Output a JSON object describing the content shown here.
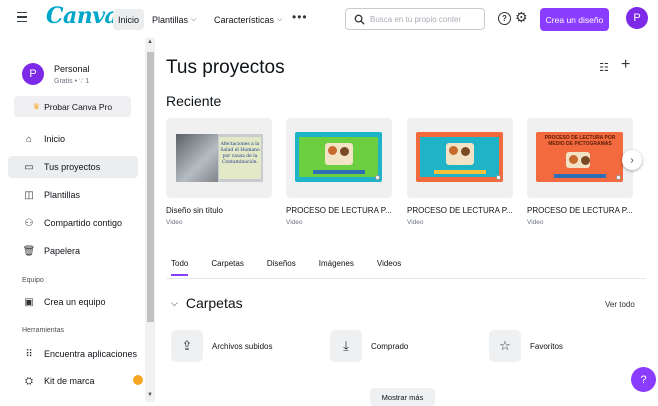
{
  "topbar": {
    "logo": "Canva",
    "nav": [
      {
        "label": "Inicio",
        "active": true
      },
      {
        "label": "Plantillas",
        "chevron": "⌵"
      },
      {
        "label": "Características",
        "chevron": "⌵"
      }
    ],
    "more": "•••",
    "search_placeholder": "Busca en tu propio conter",
    "create_label": "Crea un diseño",
    "avatar_letter": "P",
    "help_glyph": "?",
    "gear_glyph": "⚙"
  },
  "sidebar": {
    "profile": {
      "letter": "P",
      "name": "Personal",
      "sub": "Gratis • ∵ 1"
    },
    "pro_button": "Probar Canva Pro",
    "items": [
      {
        "label": "Inicio",
        "icon": "⌂"
      },
      {
        "label": "Tus proyectos",
        "icon": "▭",
        "active": true
      },
      {
        "label": "Plantillas",
        "icon": "◫"
      },
      {
        "label": "Compartido contigo",
        "icon": "⚇"
      },
      {
        "label": "Papelera",
        "icon": "🗑"
      }
    ],
    "team_section": "Equipo",
    "team_item": {
      "label": "Crea un equipo",
      "icon": "▣"
    },
    "tools_section": "Herramientas",
    "tools_items": [
      {
        "label": "Encuentra aplicaciones",
        "icon": "⠿"
      },
      {
        "label": "Kit de marca",
        "icon": "⛭"
      }
    ]
  },
  "main": {
    "title": "Tus proyectos",
    "recent_heading": "Reciente",
    "cards": [
      {
        "title": "Diseño sin título",
        "type": "Video",
        "slide_text": "Afectaciones a la Salud el Humano por causa de la Contaminación."
      },
      {
        "title": "PROCESO DE LECTURA P...",
        "type": "Video"
      },
      {
        "title": "PROCESO DE LECTURA P...",
        "type": "Video"
      },
      {
        "title": "PROCESO DE LECTURA P...",
        "type": "Video",
        "slide_text": "PROCESO DE LECTURA POR MEDIO DE PICTOGRAMAS"
      }
    ],
    "tabs": [
      "Todo",
      "Carpetas",
      "Diseños",
      "Imágenes",
      "Videos"
    ],
    "folders_heading": "Carpetas",
    "view_all": "Ver todo",
    "folders": [
      {
        "label": "Archivos subidos",
        "icon": "⇪"
      },
      {
        "label": "Comprado",
        "icon": "⤓"
      },
      {
        "label": "Favoritos",
        "icon": "☆"
      }
    ],
    "show_more": "Mostrar más"
  },
  "colors": {
    "accent": "#8b3dff",
    "logo": "#00a6c8"
  }
}
